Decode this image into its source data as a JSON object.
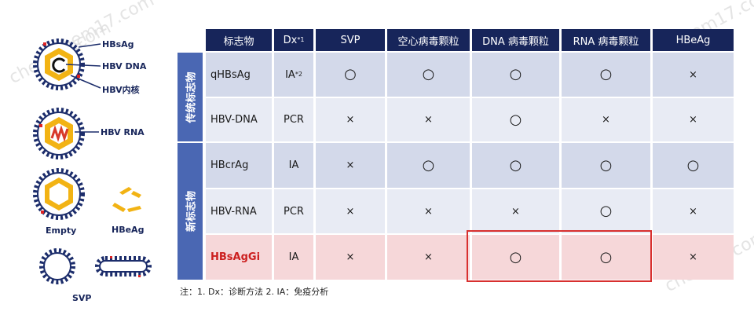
{
  "watermark": "chem17.com",
  "diagram": {
    "hbsag_label": "HBsAg",
    "hbv_dna_label": "HBV DNA",
    "hbv_core_label": "HBV内核",
    "hbv_rna_label": "HBV RNA",
    "empty_label": "Empty",
    "hbeag_label": "HBeAg",
    "svp_label": "SVP"
  },
  "table": {
    "headers": [
      {
        "text": "标志物",
        "sup": ""
      },
      {
        "text": "Dx",
        "sup": "*1"
      },
      {
        "text": "SVP",
        "sup": ""
      },
      {
        "text": "空心病毒颗粒",
        "sup": ""
      },
      {
        "text": "DNA 病毒颗粒",
        "sup": ""
      },
      {
        "text": "RNA 病毒颗粒",
        "sup": ""
      },
      {
        "text": "HBeAg",
        "sup": ""
      }
    ],
    "groups": [
      {
        "label": "传统标志物"
      },
      {
        "label": "新标志物"
      }
    ],
    "rows": [
      {
        "marker": "qHBsAg",
        "dx": "IA",
        "dx_sup": "*2",
        "vals": [
          "○",
          "○",
          "○",
          "○",
          "×"
        ]
      },
      {
        "marker": "HBV-DNA",
        "dx": "PCR",
        "dx_sup": "",
        "vals": [
          "×",
          "×",
          "○",
          "×",
          "×"
        ]
      },
      {
        "marker": "HBcrAg",
        "dx": "IA",
        "dx_sup": "",
        "vals": [
          "×",
          "○",
          "○",
          "○",
          "○"
        ]
      },
      {
        "marker": "HBV-RNA",
        "dx": "PCR",
        "dx_sup": "",
        "vals": [
          "×",
          "×",
          "×",
          "○",
          "×"
        ]
      },
      {
        "marker": "HBsAgGi",
        "dx": "IA",
        "dx_sup": "",
        "vals": [
          "×",
          "×",
          "○",
          "○",
          "×"
        ]
      }
    ]
  },
  "footnote": "注：1. Dx：诊断方法 2. IA：免疫分析",
  "colors": {
    "header_bg": "#17255a",
    "group_bg": "#4a67b3",
    "row_dark": "#d3d9ea",
    "row_light": "#e8ebf4",
    "row_highlight": "#f6d7d9",
    "highlight_border": "#d8302f",
    "accent_red": "#cc1f1f"
  }
}
